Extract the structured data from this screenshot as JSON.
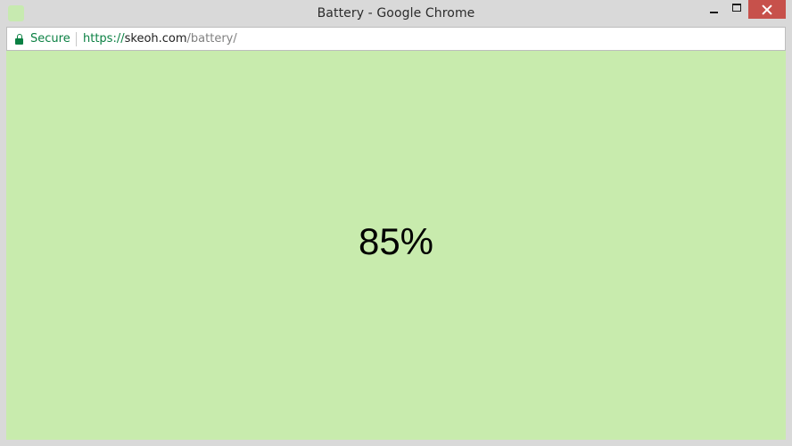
{
  "window": {
    "title": "Battery - Google Chrome",
    "icon": "page-favicon"
  },
  "titlebar": {
    "buttons": [
      "minimize",
      "maximize",
      "close"
    ],
    "close_color": "#c7514b"
  },
  "addressbar": {
    "security_icon": "lock-icon",
    "security_label": "Secure",
    "url_scheme": "https://",
    "url_host": "skeoh.com",
    "url_path": "/battery/",
    "secure_color": "#0b8043"
  },
  "page": {
    "background_color": "#c8ebad",
    "battery_level_text": "85%",
    "battery_level": 0.85
  }
}
